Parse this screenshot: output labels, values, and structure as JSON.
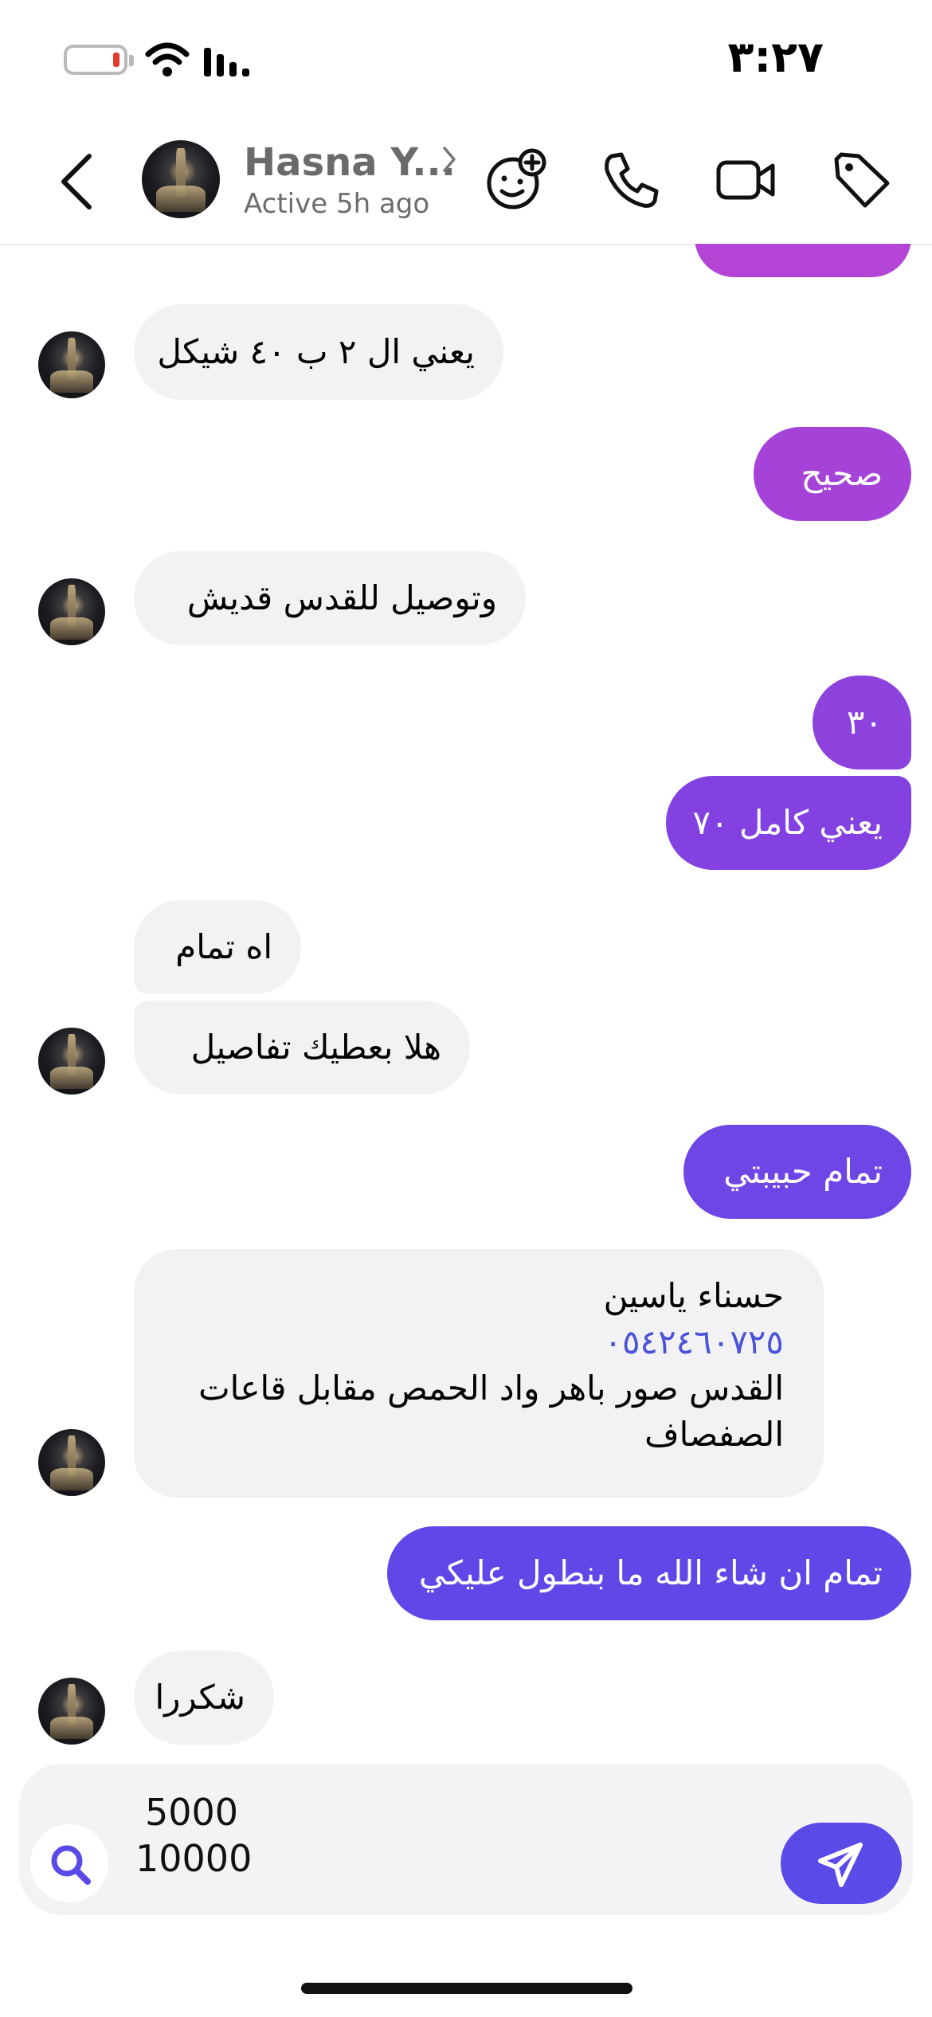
{
  "status_bar": {
    "time": "٣:٢٧",
    "battery_level": 0.1
  },
  "header": {
    "contact_name": "Hasna Y...",
    "contact_status": "Active 5h ago",
    "icons": [
      "back-chevron-icon",
      "effects-face-icon",
      "phone-icon",
      "video-camera-icon",
      "tag-icon"
    ]
  },
  "messages": [
    {
      "id": "m1",
      "direction": "outgoing",
      "text": ""
    },
    {
      "id": "m2",
      "direction": "incoming",
      "text": "يعني ال ٢ ب ٤٠ شيكل"
    },
    {
      "id": "m3",
      "direction": "outgoing",
      "text": "صحيح"
    },
    {
      "id": "m4",
      "direction": "incoming",
      "text": "وتوصيل للقدس قديش"
    },
    {
      "id": "m5",
      "direction": "outgoing",
      "text": "٣٠"
    },
    {
      "id": "m6",
      "direction": "outgoing",
      "text": "يعني كامل ٧٠"
    },
    {
      "id": "m7",
      "direction": "incoming",
      "text": "اه تمام"
    },
    {
      "id": "m8",
      "direction": "incoming",
      "text": "هلا بعطيك تفاصيل"
    },
    {
      "id": "m9",
      "direction": "outgoing",
      "text": "تمام حبيبتي"
    },
    {
      "id": "m10",
      "direction": "incoming",
      "line1": "حسناء ياسين",
      "phone": "٠٥٤٢٤٦٠٧٢٥",
      "line3": "القدس صور باهر واد الحمص مقابل قاعات",
      "line4": "الصفصاف"
    },
    {
      "id": "m11",
      "direction": "outgoing",
      "text": "تمام ان شاء الله ما بنطول عليكي"
    },
    {
      "id": "m12",
      "direction": "incoming",
      "text": "شكررا"
    }
  ],
  "composer": {
    "draft_line1": "5000",
    "draft_line2": "10000",
    "search_icon": "search-icon",
    "send_icon": "send-icon"
  },
  "colors": {
    "incoming_bubble": "#f2f2f4",
    "outgoing_gradient_top": "#b247d4",
    "outgoing_gradient_bottom": "#5a4ae8",
    "link": "#4a53d6",
    "send_button": "#5a4ae8"
  }
}
